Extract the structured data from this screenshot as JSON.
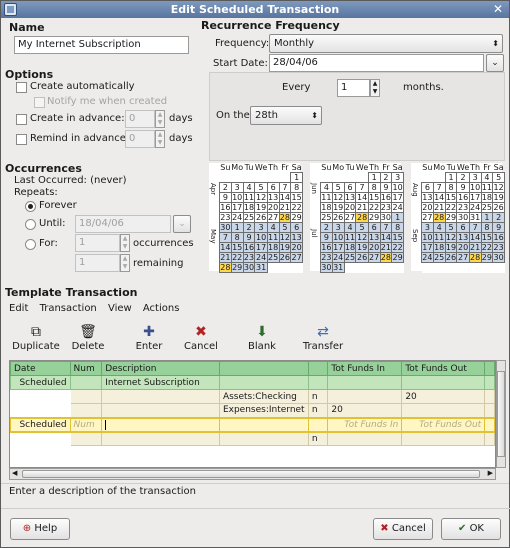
{
  "window": {
    "title": "Edit Scheduled Transaction"
  },
  "name": {
    "heading": "Name",
    "value": "My Internet Subscription"
  },
  "options": {
    "heading": "Options",
    "create_auto": "Create automatically",
    "notify": "Notify me when created",
    "create_adv": "Create in advance:",
    "create_adv_value": "0",
    "remind_adv": "Remind in advance:",
    "remind_adv_value": "0",
    "days1": "days",
    "days2": "days"
  },
  "occurrences": {
    "heading": "Occurrences",
    "last": "Last Occurred: (never)",
    "repeats": "Repeats:",
    "forever": "Forever",
    "until": "Until:",
    "until_value": "18/04/06",
    "for": "For:",
    "for_value": "1",
    "occ_label": "occurrences",
    "remaining_value": "1",
    "remaining_label": "remaining"
  },
  "recurrence": {
    "heading": "Recurrence Frequency",
    "freq_label": "Frequency:",
    "freq_value": "Monthly",
    "start_label": "Start Date:",
    "start_value": "28/04/06",
    "every_label": "Every",
    "every_value": "1",
    "months_label": "months.",
    "onthe_label": "On the",
    "onthe_value": "28th"
  },
  "calendars": {
    "days": [
      "Su",
      "Mo",
      "Tu",
      "We",
      "Th",
      "Fr",
      "Sa"
    ],
    "months": [
      {
        "labels": [
          "Apr",
          "May"
        ],
        "rows": [
          [
            "",
            "",
            "",
            "",
            "",
            "",
            "1"
          ],
          [
            "2",
            "3",
            "4",
            "5",
            "6",
            "7",
            "8"
          ],
          [
            "9",
            "10",
            "11",
            "12",
            "13",
            "14",
            "15"
          ],
          [
            "16",
            "17",
            "18",
            "19",
            "20",
            "21",
            "22"
          ],
          [
            "23",
            "24",
            "25",
            "26",
            "27",
            "28",
            "29"
          ],
          [
            "30",
            "1",
            "2",
            "3",
            "4",
            "5",
            "6"
          ],
          [
            "7",
            "8",
            "9",
            "10",
            "11",
            "12",
            "13"
          ],
          [
            "14",
            "15",
            "16",
            "17",
            "18",
            "19",
            "20"
          ],
          [
            "21",
            "22",
            "23",
            "24",
            "25",
            "26",
            "27"
          ],
          [
            "28",
            "29",
            "30",
            "31",
            "",
            "",
            ""
          ]
        ]
      },
      {
        "labels": [
          "Jun",
          "Jul"
        ],
        "rows": [
          [
            "",
            "",
            "",
            "",
            "1",
            "2",
            "3"
          ],
          [
            "4",
            "5",
            "6",
            "7",
            "8",
            "9",
            "10"
          ],
          [
            "11",
            "12",
            "13",
            "14",
            "15",
            "16",
            "17"
          ],
          [
            "18",
            "19",
            "20",
            "21",
            "22",
            "23",
            "24"
          ],
          [
            "25",
            "26",
            "27",
            "28",
            "29",
            "30",
            "1"
          ],
          [
            "2",
            "3",
            "4",
            "5",
            "6",
            "7",
            "8"
          ],
          [
            "9",
            "10",
            "11",
            "12",
            "13",
            "14",
            "15"
          ],
          [
            "16",
            "17",
            "18",
            "19",
            "20",
            "21",
            "22"
          ],
          [
            "23",
            "24",
            "25",
            "26",
            "27",
            "28",
            "29"
          ],
          [
            "30",
            "31",
            "",
            "",
            "",
            "",
            ""
          ]
        ]
      },
      {
        "labels": [
          "Aug",
          "Sep"
        ],
        "rows": [
          [
            "",
            "",
            "1",
            "2",
            "3",
            "4",
            "5"
          ],
          [
            "6",
            "7",
            "8",
            "9",
            "10",
            "11",
            "12"
          ],
          [
            "13",
            "14",
            "15",
            "16",
            "17",
            "18",
            "19"
          ],
          [
            "20",
            "21",
            "22",
            "23",
            "24",
            "25",
            "26"
          ],
          [
            "27",
            "28",
            "29",
            "30",
            "31",
            "1",
            "2"
          ],
          [
            "3",
            "4",
            "5",
            "6",
            "7",
            "8",
            "9"
          ],
          [
            "10",
            "11",
            "12",
            "13",
            "14",
            "15",
            "16"
          ],
          [
            "17",
            "18",
            "19",
            "20",
            "21",
            "22",
            "23"
          ],
          [
            "24",
            "25",
            "26",
            "27",
            "28",
            "29",
            "30"
          ],
          [
            "",
            "",
            "",
            "",
            "",
            "",
            ""
          ]
        ]
      }
    ]
  },
  "template": {
    "heading": "Template Transaction",
    "menu": [
      "Edit",
      "Transaction",
      "View",
      "Actions"
    ],
    "toolbar": [
      "Duplicate",
      "Delete",
      "Enter",
      "Cancel",
      "Blank",
      "Transfer"
    ]
  },
  "register": {
    "headers": [
      "Date",
      "Num",
      "Description",
      "",
      "",
      "Tot Funds In",
      "Tot Funds Out"
    ],
    "row1": [
      "Scheduled",
      "",
      "Internet Subscription",
      "",
      "",
      "",
      ""
    ],
    "split1": {
      "account": "Assets:Checking",
      "r": "n",
      "in": "",
      "out": "20"
    },
    "split2": {
      "account": "Expenses:Internet",
      "r": "n",
      "in": "20",
      "out": ""
    },
    "blank": {
      "date": "Scheduled",
      "num": "Num",
      "in": "Tot Funds In",
      "out": "Tot Funds Out"
    },
    "blank_split_r": "n"
  },
  "status": "Enter a description of the transaction",
  "buttons": {
    "help": "Help",
    "cancel": "Cancel",
    "ok": "OK"
  }
}
